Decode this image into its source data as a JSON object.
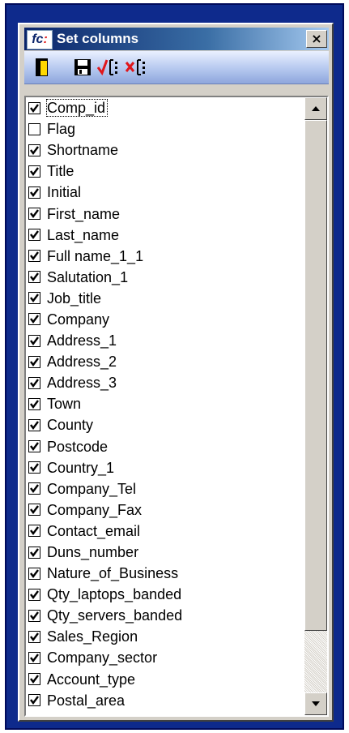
{
  "window": {
    "logo_text": "fc",
    "logo_colon": ":",
    "title": "Set columns",
    "close_label": "×"
  },
  "toolbar": {
    "buttons": [
      {
        "icon": "exit-door-icon"
      },
      {
        "icon": "save-disk-icon"
      },
      {
        "icon": "select-all-icon"
      },
      {
        "icon": "deselect-all-icon"
      }
    ]
  },
  "columns": [
    {
      "label": "Comp_id",
      "checked": true
    },
    {
      "label": "Flag",
      "checked": false
    },
    {
      "label": "Shortname",
      "checked": true
    },
    {
      "label": "Title",
      "checked": true
    },
    {
      "label": "Initial",
      "checked": true
    },
    {
      "label": "First_name",
      "checked": true
    },
    {
      "label": "Last_name",
      "checked": true
    },
    {
      "label": "Full name_1_1",
      "checked": true
    },
    {
      "label": "Salutation_1",
      "checked": true
    },
    {
      "label": "Job_title",
      "checked": true
    },
    {
      "label": "Company",
      "checked": true
    },
    {
      "label": "Address_1",
      "checked": true
    },
    {
      "label": "Address_2",
      "checked": true
    },
    {
      "label": "Address_3",
      "checked": true
    },
    {
      "label": "Town",
      "checked": true
    },
    {
      "label": "County",
      "checked": true
    },
    {
      "label": "Postcode",
      "checked": true
    },
    {
      "label": "Country_1",
      "checked": true
    },
    {
      "label": "Company_Tel",
      "checked": true
    },
    {
      "label": "Company_Fax",
      "checked": true
    },
    {
      "label": "Contact_email",
      "checked": true
    },
    {
      "label": "Duns_number",
      "checked": true
    },
    {
      "label": "Nature_of_Business",
      "checked": true
    },
    {
      "label": "Qty_laptops_banded",
      "checked": true
    },
    {
      "label": "Qty_servers_banded",
      "checked": true
    },
    {
      "label": "Sales_Region",
      "checked": true
    },
    {
      "label": "Company_sector",
      "checked": true
    },
    {
      "label": "Account_type",
      "checked": true
    },
    {
      "label": "Postal_area",
      "checked": true
    }
  ],
  "colors": {
    "title_bar": "#0a246a",
    "frame": "#0e2a8c",
    "dialog_face": "#d4d0c8"
  }
}
